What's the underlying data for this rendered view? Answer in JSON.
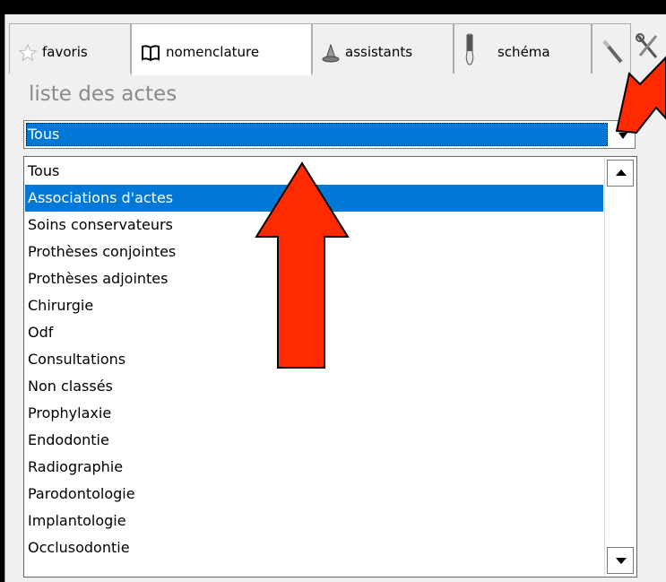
{
  "tabs": [
    {
      "label": "favoris",
      "icon": "star-icon"
    },
    {
      "label": "nomenclature",
      "icon": "book-icon"
    },
    {
      "label": "assistants",
      "icon": "wizard-hat-icon"
    },
    {
      "label": "schéma",
      "icon": "tooth-icon"
    },
    {
      "label": "",
      "icon": "pen-icon"
    },
    {
      "label": "",
      "icon": "tools-icon"
    }
  ],
  "section_title": "liste des actes",
  "combo": {
    "selected": "Tous"
  },
  "dropdown": {
    "items": [
      "Tous",
      "Associations d'actes",
      "Soins conservateurs",
      "Prothèses conjointes",
      "Prothèses adjointes",
      "Chirurgie",
      "Odf",
      "Consultations",
      "Non classés",
      "Prophylaxie",
      "Endodontie",
      "Radiographie",
      "Parodontologie",
      "Implantologie",
      "Occlusodontie"
    ],
    "highlighted": "Associations d'actes"
  },
  "colors": {
    "selection": "#0078d7",
    "annotation_arrow": "#ff2a00"
  }
}
